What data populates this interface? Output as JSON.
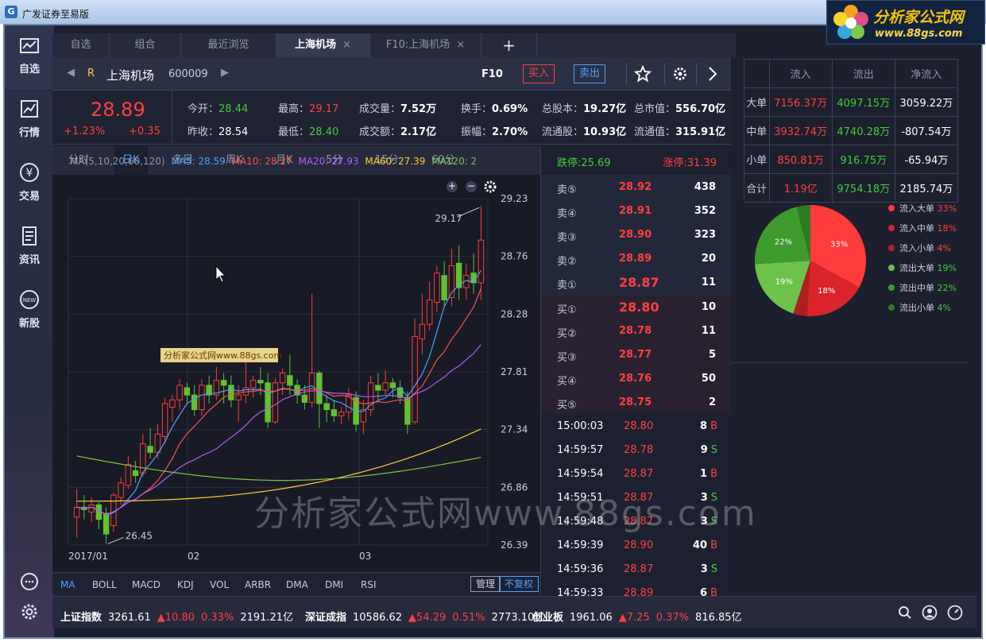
{
  "window": {
    "title": "广发证券至易版"
  },
  "brand": {
    "name": "分析家公式网",
    "url": "www.88gs.com"
  },
  "sidebar": [
    {
      "label": "自选",
      "icon": "watchlist-icon"
    },
    {
      "label": "行情",
      "icon": "market-chart-icon"
    },
    {
      "label": "交易",
      "icon": "yen-icon"
    },
    {
      "label": "资讯",
      "icon": "news-icon"
    },
    {
      "label": "新股",
      "icon": "new-stock-icon"
    }
  ],
  "tabs": [
    {
      "label": "自选"
    },
    {
      "label": "组合"
    },
    {
      "label": "最近浏览"
    },
    {
      "label": "上海机场",
      "close": "×"
    },
    {
      "label": "F10:上海机场",
      "close": "×"
    },
    {
      "label": "+"
    }
  ],
  "stock": {
    "flag": "R",
    "name": "上海机场",
    "code": "600009",
    "f10": "F10",
    "buy": "买入",
    "sell": "卖出"
  },
  "quote": {
    "price": "28.89",
    "change_pct": "+1.23%",
    "change": "+0.35",
    "open_label": "今开：",
    "open": "28.44",
    "prev_label": "昨收：",
    "prev": "28.54",
    "high_label": "最高：",
    "high": "29.17",
    "low_label": "最低：",
    "low": "28.40",
    "vol_label": "成交量：",
    "vol": "7.52万",
    "amt_label": "成交额：",
    "amt": "2.17亿",
    "turn_label": "换手：",
    "turn": "0.69%",
    "amp_label": "振幅：",
    "amp": "2.70%",
    "shares_label": "总股本：",
    "shares": "19.27亿",
    "mcap_label": "总市值：",
    "mcap": "556.70亿",
    "float_label": "流通股：",
    "float": "10.93亿",
    "fcap_label": "流通值：",
    "fcap": "315.91亿"
  },
  "periods": [
    "分时",
    "日K",
    "多日",
    "周K",
    "月K",
    "5分",
    "15分",
    "60分"
  ],
  "ma": {
    "title": "MA(5,10,20,60,120)",
    "ma5": "MA5: 28.59",
    "ma10": "MA10: 28.27",
    "ma20": "MA20: 27.93",
    "ma60": "MA60: 27.39",
    "ma120": "MA120: 2"
  },
  "indicators": [
    "MA",
    "BOLL",
    "MACD",
    "KDJ",
    "VOL",
    "ARBR",
    "DMA",
    "DMI",
    "RSI"
  ],
  "indicator_buttons": {
    "manage": "管理",
    "adjust": "不复权"
  },
  "limits": {
    "down": "跌停:25.69",
    "up": "涨停:31.39"
  },
  "asks": [
    {
      "l": "卖⑤",
      "p": "28.92",
      "v": "438"
    },
    {
      "l": "卖④",
      "p": "28.91",
      "v": "352"
    },
    {
      "l": "卖③",
      "p": "28.90",
      "v": "323"
    },
    {
      "l": "卖②",
      "p": "28.89",
      "v": "20"
    },
    {
      "l": "卖①",
      "p": "28.87",
      "v": "11"
    }
  ],
  "bids": [
    {
      "l": "买①",
      "p": "28.80",
      "v": "10"
    },
    {
      "l": "买②",
      "p": "28.78",
      "v": "11"
    },
    {
      "l": "买③",
      "p": "28.77",
      "v": "5"
    },
    {
      "l": "买④",
      "p": "28.76",
      "v": "50"
    },
    {
      "l": "买⑤",
      "p": "28.75",
      "v": "2"
    }
  ],
  "ticks": [
    {
      "t": "15:00:03",
      "p": "28.80",
      "v": "8",
      "s": "B"
    },
    {
      "t": "14:59:57",
      "p": "28.78",
      "v": "9",
      "s": "S"
    },
    {
      "t": "14:59:54",
      "p": "28.87",
      "v": "1",
      "s": "B"
    },
    {
      "t": "14:59:51",
      "p": "28.87",
      "v": "3",
      "s": "S"
    },
    {
      "t": "14:59:48",
      "p": "28.87",
      "v": "3",
      "s": "S"
    },
    {
      "t": "14:59:39",
      "p": "28.90",
      "v": "40",
      "s": "B"
    },
    {
      "t": "14:59:36",
      "p": "28.87",
      "v": "3",
      "s": "S"
    },
    {
      "t": "14:59:33",
      "p": "28.89",
      "v": "6",
      "s": "B"
    }
  ],
  "flow": {
    "headers": [
      "",
      "流入",
      "流出",
      "净流入"
    ],
    "rows": [
      [
        "大单",
        "7156.37万",
        "4097.15万",
        "3059.22万"
      ],
      [
        "中单",
        "3932.74万",
        "4740.28万",
        "-807.54万"
      ],
      [
        "小单",
        "850.81万",
        "916.75万",
        "-65.94万"
      ],
      [
        "合计",
        "1.19亿",
        "9754.18万",
        "2185.74万"
      ]
    ]
  },
  "pie": [
    {
      "name": "流入大单",
      "pct": 33,
      "label": "33%",
      "color": "#ff3b3b"
    },
    {
      "name": "流入中单",
      "pct": 18,
      "label": "18%",
      "color": "#d9242b"
    },
    {
      "name": "流入小单",
      "pct": 4,
      "label": "4%",
      "color": "#b01e22"
    },
    {
      "name": "流出大单",
      "pct": 19,
      "label": "19%",
      "color": "#6cc24a"
    },
    {
      "name": "流出中单",
      "pct": 22,
      "label": "22%",
      "color": "#3f9a2e"
    },
    {
      "name": "流出小单",
      "pct": 4,
      "label": "4%",
      "color": "#2f7a24"
    }
  ],
  "indices": [
    {
      "name": "上证指数",
      "val": "3261.61",
      "chg": "10.80",
      "pct": "0.33%",
      "amt": "2191.21亿"
    },
    {
      "name": "深证成指",
      "val": "10586.62",
      "chg": "54.29",
      "pct": "0.51%",
      "amt": "2773.10亿"
    },
    {
      "name": "创业板",
      "val": "1961.06",
      "chg": "7.25",
      "pct": "0.37%",
      "amt": "816.85亿"
    }
  ],
  "chart_data": {
    "type": "candlestick",
    "title": "",
    "y_ticks": [
      "29.23",
      "28.76",
      "28.28",
      "27.81",
      "27.34",
      "26.86",
      "26.39"
    ],
    "x_ticks": [
      "2017/01",
      "02",
      "03"
    ],
    "ylim": [
      26.39,
      29.23
    ],
    "annot_high": "29.17",
    "annot_low": "26.45",
    "wm_label": "分析家公式网www.88gs.com",
    "candles": [
      [
        26.62,
        26.7,
        26.45,
        26.85
      ],
      [
        26.7,
        26.68,
        26.6,
        26.8
      ],
      [
        26.66,
        26.72,
        26.58,
        26.78
      ],
      [
        26.72,
        26.6,
        26.52,
        26.74
      ],
      [
        26.65,
        26.48,
        26.4,
        26.7
      ],
      [
        26.55,
        26.8,
        26.5,
        26.82
      ],
      [
        26.78,
        26.9,
        26.72,
        26.95
      ],
      [
        26.88,
        27.05,
        26.85,
        27.12
      ],
      [
        27.0,
        26.96,
        26.9,
        27.08
      ],
      [
        26.98,
        27.22,
        26.95,
        27.3
      ],
      [
        27.2,
        27.15,
        27.1,
        27.35
      ],
      [
        27.15,
        27.3,
        27.1,
        27.38
      ],
      [
        27.28,
        27.55,
        27.22,
        27.6
      ],
      [
        27.52,
        27.58,
        27.4,
        27.62
      ],
      [
        27.58,
        27.7,
        27.5,
        27.75
      ],
      [
        27.68,
        27.62,
        27.55,
        27.72
      ],
      [
        27.62,
        27.5,
        27.45,
        27.7
      ],
      [
        27.5,
        27.7,
        27.45,
        27.75
      ],
      [
        27.7,
        27.62,
        27.55,
        27.78
      ],
      [
        27.62,
        27.74,
        27.58,
        27.85
      ],
      [
        27.74,
        27.7,
        27.55,
        27.8
      ],
      [
        27.7,
        27.58,
        27.52,
        27.78
      ],
      [
        27.58,
        27.62,
        27.4,
        27.7
      ],
      [
        27.62,
        27.68,
        27.55,
        27.9
      ],
      [
        27.68,
        27.74,
        27.6,
        27.78
      ],
      [
        27.74,
        27.72,
        27.62,
        27.85
      ],
      [
        27.72,
        27.4,
        27.35,
        27.8
      ],
      [
        27.4,
        27.72,
        27.38,
        27.76
      ],
      [
        27.72,
        27.8,
        27.62,
        27.84
      ],
      [
        27.78,
        27.7,
        27.62,
        27.95
      ],
      [
        27.7,
        27.62,
        27.55,
        27.75
      ],
      [
        27.62,
        27.56,
        27.5,
        27.7
      ],
      [
        27.56,
        27.8,
        27.52,
        28.45
      ],
      [
        27.8,
        27.55,
        27.35,
        27.82
      ],
      [
        27.55,
        27.5,
        27.4,
        27.62
      ],
      [
        27.5,
        27.45,
        27.4,
        27.58
      ],
      [
        27.45,
        27.48,
        27.38,
        27.52
      ],
      [
        27.48,
        27.62,
        27.42,
        27.68
      ],
      [
        27.6,
        27.38,
        27.32,
        27.65
      ],
      [
        27.4,
        27.5,
        27.3,
        27.58
      ],
      [
        27.5,
        27.72,
        27.45,
        27.78
      ],
      [
        27.7,
        27.66,
        27.58,
        27.8
      ],
      [
        27.66,
        27.72,
        27.62,
        27.82
      ],
      [
        27.72,
        27.68,
        27.6,
        27.76
      ],
      [
        27.68,
        27.6,
        27.55,
        27.74
      ],
      [
        27.6,
        27.38,
        27.3,
        27.65
      ],
      [
        27.4,
        28.1,
        27.38,
        28.25
      ],
      [
        28.08,
        28.2,
        27.95,
        28.45
      ],
      [
        28.2,
        28.4,
        28.15,
        28.55
      ],
      [
        28.38,
        28.62,
        28.3,
        28.68
      ],
      [
        28.6,
        28.4,
        28.35,
        28.72
      ],
      [
        28.42,
        28.68,
        28.35,
        28.82
      ],
      [
        28.7,
        28.5,
        28.4,
        28.85
      ],
      [
        28.5,
        28.6,
        28.4,
        28.7
      ],
      [
        28.62,
        28.54,
        28.45,
        28.78
      ],
      [
        28.54,
        28.89,
        28.4,
        29.17
      ]
    ]
  }
}
